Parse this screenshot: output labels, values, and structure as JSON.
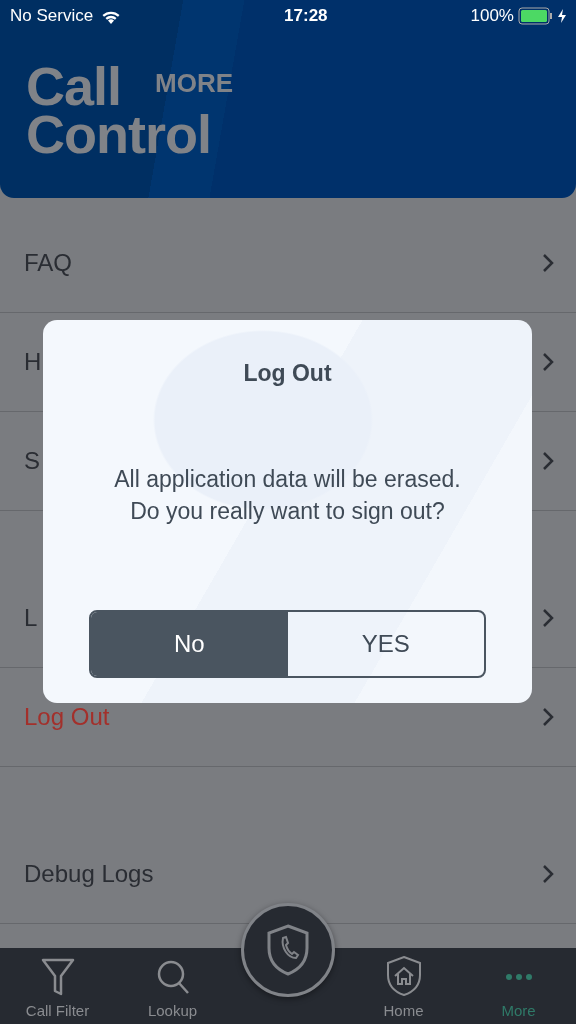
{
  "status_bar": {
    "carrier": "No Service",
    "time": "17:28",
    "battery": "100%"
  },
  "header": {
    "title_lines": [
      "Call",
      "Control"
    ],
    "section": "MORE"
  },
  "sections": [
    {
      "items": [
        {
          "label": "FAQ",
          "kind": "normal"
        },
        {
          "label": "H",
          "kind": "normal"
        },
        {
          "label": "S",
          "kind": "normal"
        }
      ]
    },
    {
      "items": [
        {
          "label": "L",
          "kind": "normal"
        },
        {
          "label": "Log Out",
          "kind": "destructive"
        }
      ]
    },
    {
      "items": [
        {
          "label": "Debug Logs",
          "kind": "normal"
        }
      ]
    }
  ],
  "dialog": {
    "title": "Log Out",
    "message": "All application data will be erased.\nDo you really want to sign out?",
    "buttons": [
      {
        "label": "No",
        "selected": true
      },
      {
        "label": "YES",
        "selected": false
      }
    ]
  },
  "tabs": [
    {
      "label": "Call Filter",
      "selected": false
    },
    {
      "label": "Lookup",
      "selected": false
    },
    {
      "label": "Home",
      "selected": false
    },
    {
      "label": "More",
      "selected": true
    }
  ]
}
